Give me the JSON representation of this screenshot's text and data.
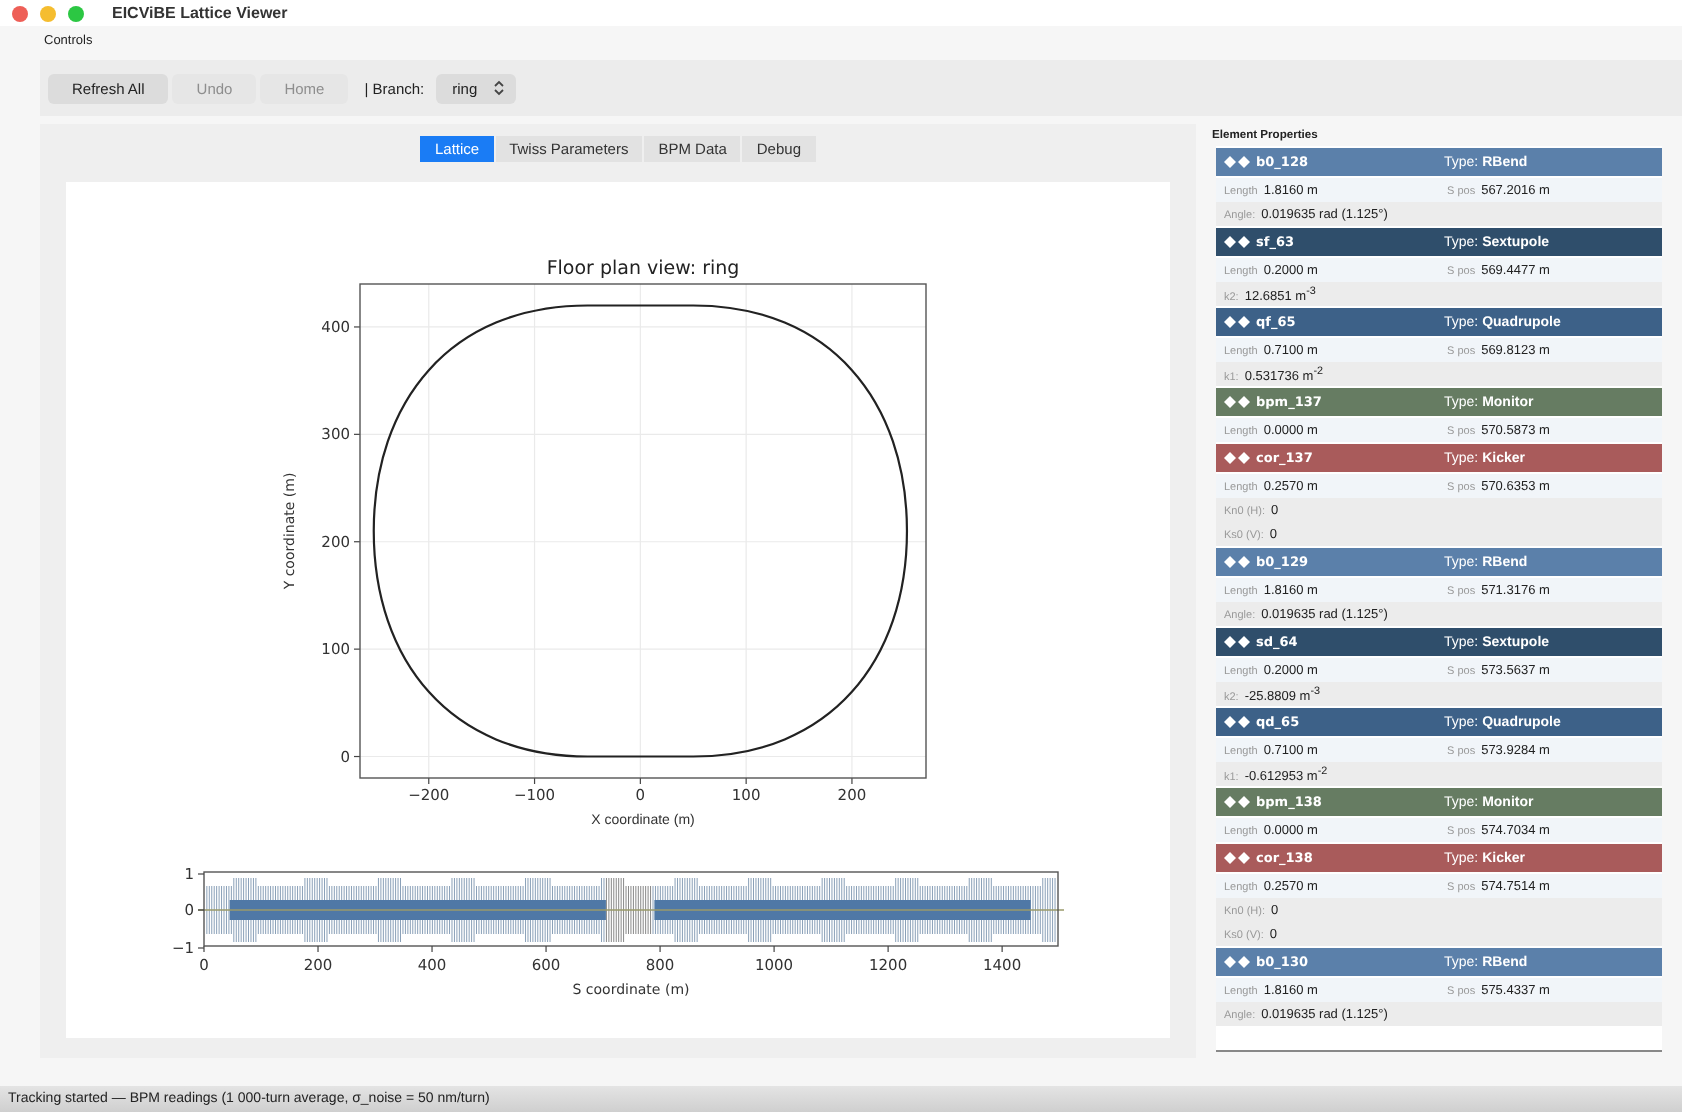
{
  "window": {
    "title": "EICViBE Lattice Viewer"
  },
  "controls": {
    "title": "Controls",
    "buttons": [
      {
        "label": "Refresh All",
        "disabled": false
      },
      {
        "label": "Undo",
        "disabled": true
      },
      {
        "label": "Home",
        "disabled": true
      }
    ],
    "branch_label": "| Branch:",
    "branch_value": "ring"
  },
  "tabs": [
    {
      "label": "Lattice",
      "selected": true
    },
    {
      "label": "Twiss Parameters",
      "selected": false
    },
    {
      "label": "BPM Data",
      "selected": false
    },
    {
      "label": "Debug",
      "selected": false
    }
  ],
  "floor_plan": {
    "chart_data": {
      "type": "line",
      "title": "Floor plan view: ring",
      "xlabel": "X coordinate (m)",
      "ylabel": "Y coordinate (m)",
      "xlim": [
        -265,
        270
      ],
      "ylim": [
        -20,
        440
      ],
      "xticks": [
        {
          "value": -200,
          "label": "−200"
        },
        {
          "value": -100,
          "label": "−100"
        },
        {
          "value": 0,
          "label": "0"
        },
        {
          "value": 100,
          "label": "100"
        },
        {
          "value": 200,
          "label": "200"
        }
      ],
      "yticks": [
        0,
        100,
        200,
        300,
        400
      ],
      "grid": true
    }
  },
  "layout_plot": {
    "yticks": [
      "1",
      "0",
      "−1"
    ],
    "xticks": [
      "0",
      "200",
      "400",
      "600",
      "800",
      "1000",
      "1200",
      "1400"
    ],
    "xlabel": "S coordinate (m)"
  },
  "element_properties": {
    "title": "Element Properties",
    "elements": [
      {
        "name": "b0_128",
        "type_label": "Type:",
        "type": "RBend",
        "color": "#5b80aa",
        "rows": [
          [
            {
              "label": "Length",
              "value": "1.8160 m"
            },
            {
              "label": "S pos",
              "value": "567.2016 m"
            }
          ],
          [
            {
              "label": "Angle:",
              "value": "0.019635 rad (1.125°)"
            }
          ]
        ]
      },
      {
        "name": "sf_63",
        "type_label": "Type:",
        "type": "Sextupole",
        "color": "#2f4e6b",
        "rows": [
          [
            {
              "label": "Length",
              "value": "0.2000 m"
            },
            {
              "label": "S pos",
              "value": "569.4477 m"
            }
          ],
          [
            {
              "label": "k2:",
              "value": "12.6851 m$^{-3}$"
            }
          ]
        ]
      },
      {
        "name": "qf_65",
        "type_label": "Type:",
        "type": "Quadrupole",
        "color": "#3d6188",
        "rows": [
          [
            {
              "label": "Length",
              "value": "0.7100 m"
            },
            {
              "label": "S pos",
              "value": "569.8123 m"
            }
          ],
          [
            {
              "label": "k1:",
              "value": "0.531736 m$^{-2}$"
            }
          ]
        ]
      },
      {
        "name": "bpm_137",
        "type_label": "Type:",
        "type": "Monitor",
        "color": "#667c62",
        "rows": [
          [
            {
              "label": "Length",
              "value": "0.0000 m"
            },
            {
              "label": "S pos",
              "value": "570.5873 m"
            }
          ]
        ]
      },
      {
        "name": "cor_137",
        "type_label": "Type:",
        "type": "Kicker",
        "color": "#a95b5b",
        "rows": [
          [
            {
              "label": "Length",
              "value": "0.2570 m"
            },
            {
              "label": "S pos",
              "value": "570.6353 m"
            }
          ],
          [
            {
              "label": "Kn0 (H):",
              "value": "0"
            }
          ],
          [
            {
              "label": "Ks0 (V):",
              "value": "0"
            }
          ]
        ]
      },
      {
        "name": "b0_129",
        "type_label": "Type:",
        "type": "RBend",
        "color": "#5b80aa",
        "rows": [
          [
            {
              "label": "Length",
              "value": "1.8160 m"
            },
            {
              "label": "S pos",
              "value": "571.3176 m"
            }
          ],
          [
            {
              "label": "Angle:",
              "value": "0.019635 rad (1.125°)"
            }
          ]
        ]
      },
      {
        "name": "sd_64",
        "type_label": "Type:",
        "type": "Sextupole",
        "color": "#2f4e6b",
        "rows": [
          [
            {
              "label": "Length",
              "value": "0.2000 m"
            },
            {
              "label": "S pos",
              "value": "573.5637 m"
            }
          ],
          [
            {
              "label": "k2:",
              "value": "-25.8809 m$^{-3}$"
            }
          ]
        ]
      },
      {
        "name": "qd_65",
        "type_label": "Type:",
        "type": "Quadrupole",
        "color": "#3d6188",
        "rows": [
          [
            {
              "label": "Length",
              "value": "0.7100 m"
            },
            {
              "label": "S pos",
              "value": "573.9284 m"
            }
          ],
          [
            {
              "label": "k1:",
              "value": "-0.612953 m$^{-2}$"
            }
          ]
        ]
      },
      {
        "name": "bpm_138",
        "type_label": "Type:",
        "type": "Monitor",
        "color": "#667c62",
        "rows": [
          [
            {
              "label": "Length",
              "value": "0.0000 m"
            },
            {
              "label": "S pos",
              "value": "574.7034 m"
            }
          ]
        ]
      },
      {
        "name": "cor_138",
        "type_label": "Type:",
        "type": "Kicker",
        "color": "#a95b5b",
        "rows": [
          [
            {
              "label": "Length",
              "value": "0.2570 m"
            },
            {
              "label": "S pos",
              "value": "574.7514 m"
            }
          ],
          [
            {
              "label": "Kn0 (H):",
              "value": "0"
            }
          ],
          [
            {
              "label": "Ks0 (V):",
              "value": "0"
            }
          ]
        ]
      },
      {
        "name": "b0_130",
        "type_label": "Type:",
        "type": "RBend",
        "color": "#5b80aa",
        "rows": [
          [
            {
              "label": "Length",
              "value": "1.8160 m"
            },
            {
              "label": "S pos",
              "value": "575.4337 m"
            }
          ],
          [
            {
              "label": "Angle:",
              "value": "0.019635 rad (1.125°)"
            }
          ]
        ]
      }
    ]
  },
  "status_bar": "Tracking started — BPM readings (1 000-turn average, σ_noise = 50 nm/turn)"
}
